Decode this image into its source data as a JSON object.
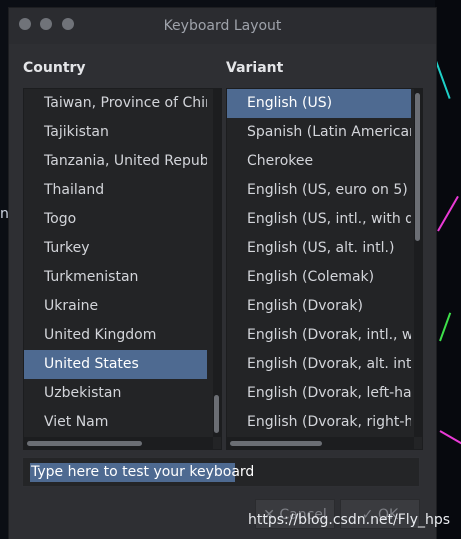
{
  "window": {
    "title": "Keyboard Layout"
  },
  "country": {
    "label": "Country",
    "items": [
      "Taiwan, Province of China",
      "Tajikistan",
      "Tanzania, United Republic of",
      "Thailand",
      "Togo",
      "Turkey",
      "Turkmenistan",
      "Ukraine",
      "United Kingdom",
      "United States",
      "Uzbekistan",
      "Viet Nam"
    ],
    "selected": "United States"
  },
  "variant": {
    "label": "Variant",
    "items": [
      "English (US)",
      "Spanish (Latin American)",
      "Cherokee",
      "English (US, euro on 5)",
      "English (US, intl., with dead keys)",
      "English (US, alt. intl.)",
      "English (Colemak)",
      "English (Dvorak)",
      "English (Dvorak, intl., with dead keys)",
      "English (Dvorak, alt. intl.)",
      "English (Dvorak, left-handed)",
      "English (Dvorak, right-handed)"
    ],
    "selected": "English (US)"
  },
  "test_field": {
    "placeholder": "Type here to test your keyboard",
    "value": ""
  },
  "buttons": {
    "cancel": "Cancel",
    "ok": "OK"
  },
  "watermark": "https://blog.csdn.net/Fly_hps",
  "colors": {
    "selection": "#4e6a91",
    "window_bg": "#2e2f33",
    "list_bg": "#232426"
  }
}
